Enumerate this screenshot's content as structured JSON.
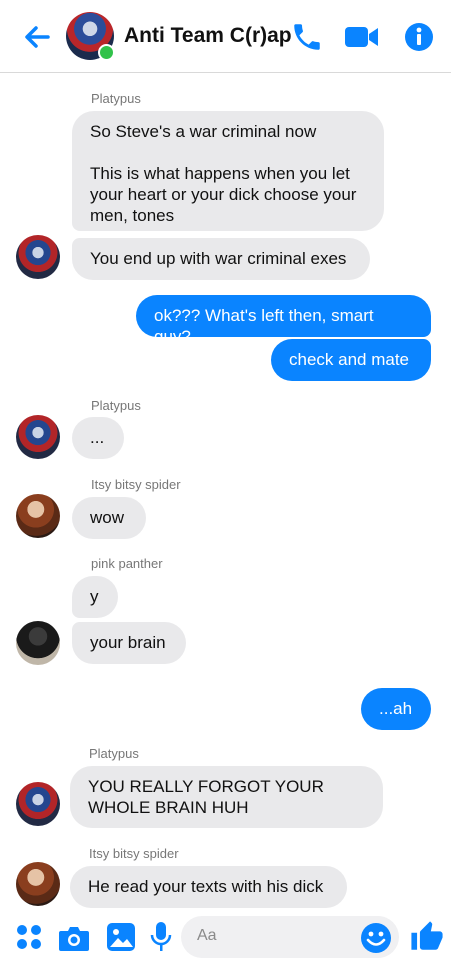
{
  "header": {
    "title": "Anti Team C(r)ap"
  },
  "colors": {
    "accent": "#0a84ff",
    "incoming_bubble": "#e9e9eb",
    "online": "#31c24a"
  },
  "icons": [
    "back-arrow-icon",
    "phone-icon",
    "video-camera-icon",
    "info-icon",
    "menu-dots-icon",
    "camera-icon",
    "image-icon",
    "microphone-icon",
    "emoji-icon",
    "thumbs-up-icon"
  ],
  "messages": [
    {
      "sender": "Platypus"
    },
    {
      "text": "So Steve's a war criminal now\n\nThis is what happens when you let your heart or your dick choose your men, tones"
    },
    {
      "text": "You end up with war criminal exes"
    },
    {
      "text": "ok??? What's left then, smart guy?"
    },
    {
      "text": "check and mate"
    },
    {
      "sender": "Platypus"
    },
    {
      "text": "..."
    },
    {
      "sender": "Itsy bitsy spider"
    },
    {
      "text": "wow"
    },
    {
      "sender": "pink panther"
    },
    {
      "text": "y"
    },
    {
      "text": "your brain"
    },
    {
      "text": "...ah"
    },
    {
      "sender": "Platypus"
    },
    {
      "text": "YOU REALLY FORGOT YOUR WHOLE BRAIN HUH"
    },
    {
      "sender": "Itsy bitsy spider"
    },
    {
      "text": "He read your texts with his dick"
    }
  ],
  "composer": {
    "placeholder": "Aa"
  }
}
